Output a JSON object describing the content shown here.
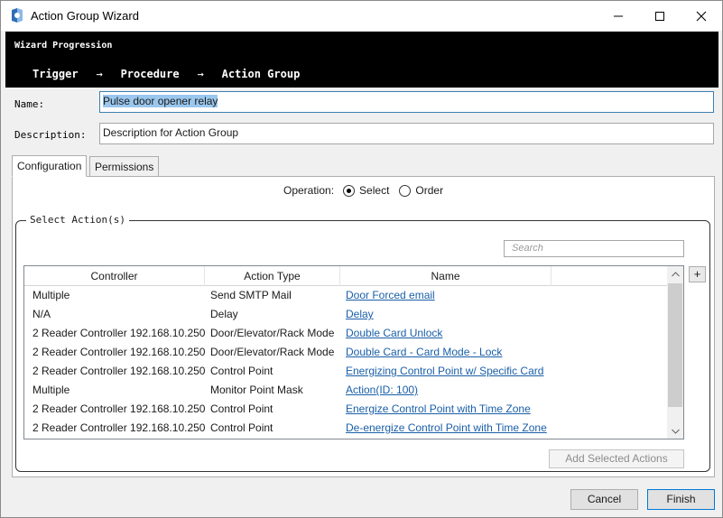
{
  "window": {
    "title": "Action Group Wizard",
    "controls": [
      "minimize-icon",
      "maximize-icon",
      "close-icon"
    ]
  },
  "banner": {
    "title": "Wizard Progression",
    "steps": [
      "Trigger",
      "Procedure",
      "Action Group"
    ],
    "separator": "→"
  },
  "form": {
    "name_label": "Name:",
    "name_value": "Pulse door opener relay",
    "description_label": "Description:",
    "description_value": "Description for Action Group"
  },
  "tabs": [
    {
      "label": "Configuration",
      "active": true
    },
    {
      "label": "Permissions",
      "active": false
    }
  ],
  "operation": {
    "label": "Operation:",
    "options": [
      {
        "label": "Select",
        "selected": true
      },
      {
        "label": "Order",
        "selected": false
      }
    ]
  },
  "select_actions": {
    "group_title": "Select Action(s)",
    "search_placeholder": "Search",
    "add_button": "+",
    "columns": [
      "Controller",
      "Action Type",
      "Name"
    ],
    "rows": [
      {
        "controller": "Multiple",
        "action_type": "Send SMTP Mail",
        "name": "Door Forced email"
      },
      {
        "controller": "N/A",
        "action_type": "Delay",
        "name": "Delay"
      },
      {
        "controller": "2 Reader Controller 192.168.10.250",
        "action_type": "Door/Elevator/Rack Mode",
        "name": "Double Card Unlock"
      },
      {
        "controller": "2 Reader Controller 192.168.10.250",
        "action_type": "Door/Elevator/Rack Mode",
        "name": "Double Card - Card Mode - Lock"
      },
      {
        "controller": "2 Reader Controller 192.168.10.250",
        "action_type": "Control Point",
        "name": "Energizing Control Point w/ Specific Card"
      },
      {
        "controller": "Multiple",
        "action_type": "Monitor Point Mask",
        "name": "Action(ID: 100)"
      },
      {
        "controller": "2 Reader Controller 192.168.10.250",
        "action_type": "Control Point",
        "name": "Energize Control Point with Time Zone"
      },
      {
        "controller": "2 Reader Controller 192.168.10.250",
        "action_type": "Control Point",
        "name": "De-energize Control Point with Time Zone"
      }
    ],
    "add_selected_label": "Add Selected Actions"
  },
  "footer": {
    "cancel_label": "Cancel",
    "finish_label": "Finish"
  },
  "colors": {
    "banner_bg": "#000000",
    "link": "#1a5fa8",
    "selection": "#9ac7ee",
    "accent_border": "#0078d7"
  }
}
